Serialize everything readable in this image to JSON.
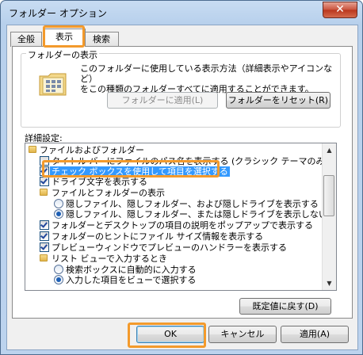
{
  "window": {
    "title": "フォルダー オプション",
    "close_glyph": "✕"
  },
  "tabs": [
    {
      "label": "全般"
    },
    {
      "label": "表示"
    },
    {
      "label": "検索"
    }
  ],
  "folder_view": {
    "group_label": "フォルダーの表示",
    "description_line1": "このフォルダーに使用している表示方法（詳細表示やアイコンなど）",
    "description_line2": "をこの種類のフォルダーすべてに適用することができます。",
    "apply_button": "フォルダーに適用(L)",
    "reset_button": "フォルダーをリセット(R)"
  },
  "advanced": {
    "label": "詳細設定:",
    "items": [
      {
        "text": "ファイルおよびフォルダー",
        "kind": "folder",
        "indent": 0
      },
      {
        "text": "タイトル バーにファイルのパス名を表示する (クラシック テーマのみ)",
        "kind": "checkbox",
        "checked": false,
        "indent": 1
      },
      {
        "text": "チェック ボックスを使用して項目を選択する",
        "kind": "checkbox",
        "checked": true,
        "selected": true,
        "indent": 1
      },
      {
        "text": "ドライブ文字を表示する",
        "kind": "checkbox",
        "checked": true,
        "indent": 1
      },
      {
        "text": "ファイルとフォルダーの表示",
        "kind": "folder",
        "indent": 1
      },
      {
        "text": "隠しファイル、隠しフォルダー、および隠しドライブを表示する",
        "kind": "radio",
        "checked": false,
        "indent": 2
      },
      {
        "text": "隠しファイル、隠しフォルダー、または隠しドライブを表示しない",
        "kind": "radio",
        "checked": true,
        "indent": 2
      },
      {
        "text": "フォルダーとデスクトップの項目の説明をポップアップで表示する",
        "kind": "checkbox",
        "checked": true,
        "indent": 1
      },
      {
        "text": "フォルダーのヒントにファイル サイズ情報を表示する",
        "kind": "checkbox",
        "checked": true,
        "indent": 1
      },
      {
        "text": "プレビューウィンドウでプレビューのハンドラーを表示する",
        "kind": "checkbox",
        "checked": true,
        "indent": 1
      },
      {
        "text": "リスト ビューで入力するとき",
        "kind": "folder",
        "indent": 1
      },
      {
        "text": "検索ボックスに自動的に入力する",
        "kind": "radio",
        "checked": false,
        "indent": 2
      },
      {
        "text": "入力した項目をビューで選択する",
        "kind": "radio",
        "checked": true,
        "indent": 2
      }
    ],
    "restore_defaults_button": "既定値に戻す(D)"
  },
  "footer": {
    "ok_button": "OK",
    "cancel_button": "キャンセル",
    "apply_button": "適用(A)"
  },
  "colors": {
    "highlight_outline": "#f39a2c",
    "selection": "#3399ff"
  }
}
